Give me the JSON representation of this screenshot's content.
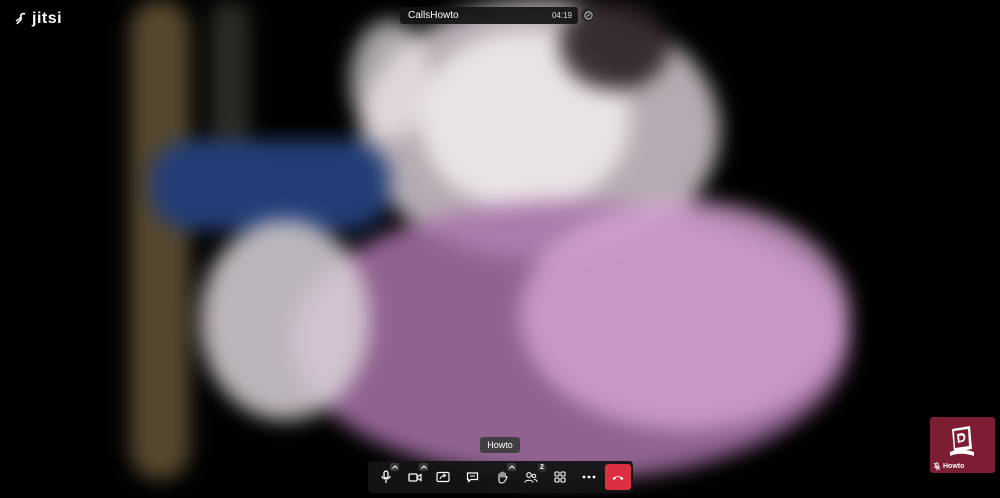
{
  "app": {
    "brand_label": "jitsi"
  },
  "meeting": {
    "name": "CallsHowto",
    "timer": "04:19"
  },
  "toolbar": {
    "tooltip": "Howto",
    "participants_count": "2",
    "buttons": [
      {
        "icon": "microphone-icon"
      },
      {
        "icon": "camera-icon"
      },
      {
        "icon": "share-screen-icon"
      },
      {
        "icon": "chat-icon"
      },
      {
        "icon": "raise-hand-icon"
      },
      {
        "icon": "participants-icon"
      },
      {
        "icon": "tile-view-icon"
      },
      {
        "icon": "more-options-icon"
      },
      {
        "icon": "hangup-icon"
      }
    ],
    "hangup_color": "#dd2e42"
  },
  "thumbnail": {
    "name": "Howto",
    "color": "#7c1d33"
  }
}
